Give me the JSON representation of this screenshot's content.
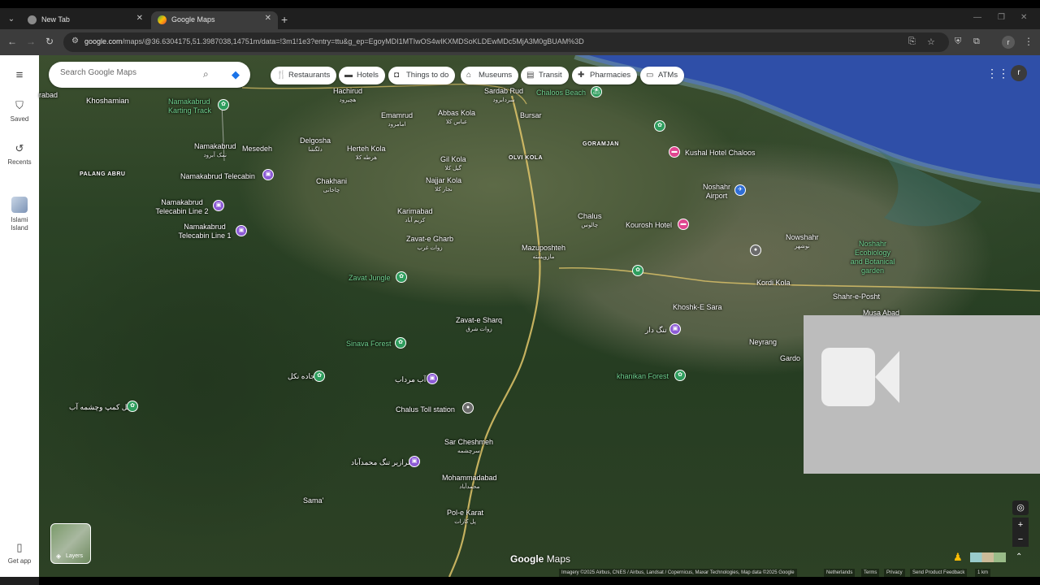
{
  "browser": {
    "tabs": [
      {
        "title": "New Tab",
        "active": false
      },
      {
        "title": "Google Maps",
        "active": true
      }
    ],
    "url_host": "google.com",
    "url_path": "/maps/@36.6304175,51.3987038,14751m/data=!3m1!1e3?entry=ttu&g_ep=EgoyMDI1MTIwOS4wIKXMDSoKLDEwMDc5MjA3M0gBUAM%3D",
    "profile_initial": "r"
  },
  "sidebar": {
    "saved": "Saved",
    "recents": "Recents",
    "island": "Islami Island",
    "get_app": "Get app"
  },
  "search": {
    "placeholder": "Search Google Maps"
  },
  "chips": [
    "Restaurants",
    "Hotels",
    "Things to do",
    "Museums",
    "Transit",
    "Pharmacies",
    "ATMs"
  ],
  "user_initial": "r",
  "places": {
    "rabad": "rabad",
    "khoshamian": "Khoshamian",
    "karting": "Namakabrud Karting Track",
    "hachirud": "Hachirud",
    "hachirud_fa": "هچیرود",
    "sardab": "Sardab Rud",
    "sardab_fa": "سردابرود",
    "chaloos_beach": "Chaloos Beach",
    "emamrud": "Emamrud",
    "emamrud_fa": "امامرود",
    "abbas": "Abbas Kola",
    "abbas_fa": "عباس کلا",
    "bursar": "Bursar",
    "goramjan": "GORAMJAN",
    "kushal": "Kushal Hotel Chaloos",
    "namakabrud": "Namakabrud",
    "namakabrud_fa": "نمک آبرود",
    "mesedeh": "Mesedeh",
    "delgosha": "Delgosha",
    "delgosha_fa": "دلگشا",
    "herteh": "Herteh Kola",
    "herteh_fa": "هرطه کلا",
    "gil": "Gil Kola",
    "gil_fa": "گیل کلا",
    "olvi": "OLVI KOLA",
    "palang": "PALANG ABRU",
    "telecabin": "Namakabrud Telecabin",
    "chakhani": "Chakhani",
    "chakhani_fa": "چاخانی",
    "najjar": "Najjar Kola",
    "najjar_fa": "نجار کلا",
    "noshahr_airport": "Noshahr Airport",
    "line2": "Namakabrud Telecabin Line 2",
    "line1": "Namakabrud Telecabin Line 1",
    "karimabad": "Karimabad",
    "karimabad_fa": "کریم آباد",
    "chalus": "Chalus",
    "chalus_fa": "چالوس",
    "kourosh": "Kourosh Hotel",
    "noshahr": "Nowshahr",
    "noshahr_fa": "نوشهر",
    "zavat_gharb": "Zavat-e Gharb",
    "zavat_gharb_fa": "زوات غرب",
    "mazuposhteh": "Mazuposhteh",
    "mazuposhteh_fa": "مازوپشته",
    "botanical": "Noshahr Ecobiology and Botanical garden",
    "zavat_jungle": "Zavat Jungle",
    "kordi": "Kordi Kola",
    "shahr": "Shahr-e-Posht",
    "khoshk": "Khoshk-E Sara",
    "musa": "Musa Abad",
    "zavat_sharq": "Zavat-e Sharq",
    "zavat_sharq_fa": "زوات شرق",
    "tang_dar": "تنگ دار",
    "sinava": "Sinava Forest",
    "neyrang": "Neyrang",
    "gardo": "Gardo",
    "jade": "جاده نکل",
    "ab_mord": "آب مرداب",
    "khanikan": "khanikan Forest",
    "mahal": "محل کمپ وچشمه آب",
    "chalus_toll": "Chalus Toll station",
    "sar_cheshmeh": "Sar Cheshmeh",
    "sar_cheshmeh_fa": "سرچشمه",
    "mohammad_poi": "سرازیر تنگ محمدآباد",
    "mohammadabad": "Mohammadabad",
    "mohammadabad_fa": "محمدآباد",
    "sama": "Sama'",
    "pole_karat": "Pol-e Karat",
    "pole_karat_fa": "پل کارات"
  },
  "map_controls": {
    "layers_label": "Layers",
    "logo_google": "Google",
    "logo_maps": "Maps",
    "attribution": "Imagery ©2025 Airbus, CNES / Airbus, Landsat / Copernicus, Maxar Technologies, Map data ©2025 Google",
    "region": "Netherlands",
    "terms": "Terms",
    "privacy": "Privacy",
    "feedback": "Send Product Feedback",
    "scale": "1 km"
  },
  "colors": {
    "sea": "#2f4fa8",
    "vegetation": "#2c4326",
    "label_green": "#6fd18f",
    "road": "#e0c56a"
  }
}
